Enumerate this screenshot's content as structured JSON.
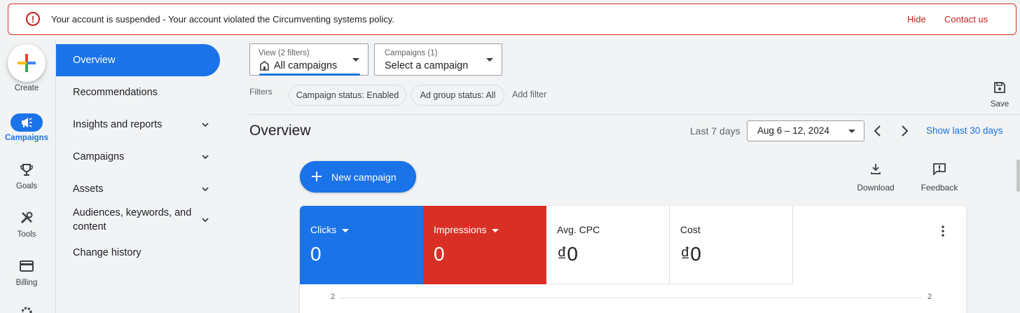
{
  "alert": {
    "message": "Your account is suspended - Your account violated the Circumventing systems policy.",
    "hide_label": "Hide",
    "contact_label": "Contact us"
  },
  "rail": {
    "create_label": "Create",
    "campaigns_label": "Campaigns",
    "goals_label": "Goals",
    "tools_label": "Tools",
    "billing_label": "Billing"
  },
  "nav": {
    "items": [
      {
        "label": "Overview"
      },
      {
        "label": "Recommendations"
      },
      {
        "label": "Insights and reports"
      },
      {
        "label": "Campaigns"
      },
      {
        "label": "Assets"
      },
      {
        "label": "Audiences, keywords, and content"
      },
      {
        "label": "Change history"
      }
    ]
  },
  "view_selector": {
    "small": "View (2 filters)",
    "value": "All campaigns"
  },
  "campaign_selector": {
    "small": "Campaigns (1)",
    "value": "Select a campaign"
  },
  "filters": {
    "label": "Filters",
    "chips": [
      "Campaign status: Enabled",
      "Ad group status: All"
    ],
    "add_label": "Add filter"
  },
  "save_label": "Save",
  "header": {
    "title": "Overview",
    "range_label": "Last 7 days",
    "date_value": "Aug 6 – 12, 2024",
    "show_last": "Show last 30 days"
  },
  "actions": {
    "new_campaign": "New campaign",
    "download": "Download",
    "feedback": "Feedback"
  },
  "metrics": [
    {
      "name": "Clicks",
      "value": "0"
    },
    {
      "name": "Impressions",
      "value": "0"
    },
    {
      "name": "Avg. CPC",
      "value": "₫0"
    },
    {
      "name": "Cost",
      "value": "₫0"
    }
  ],
  "chart": {
    "y_left": "2",
    "y_right": "2"
  },
  "colors": {
    "accent": "#1a73e8",
    "danger": "#d93025"
  }
}
